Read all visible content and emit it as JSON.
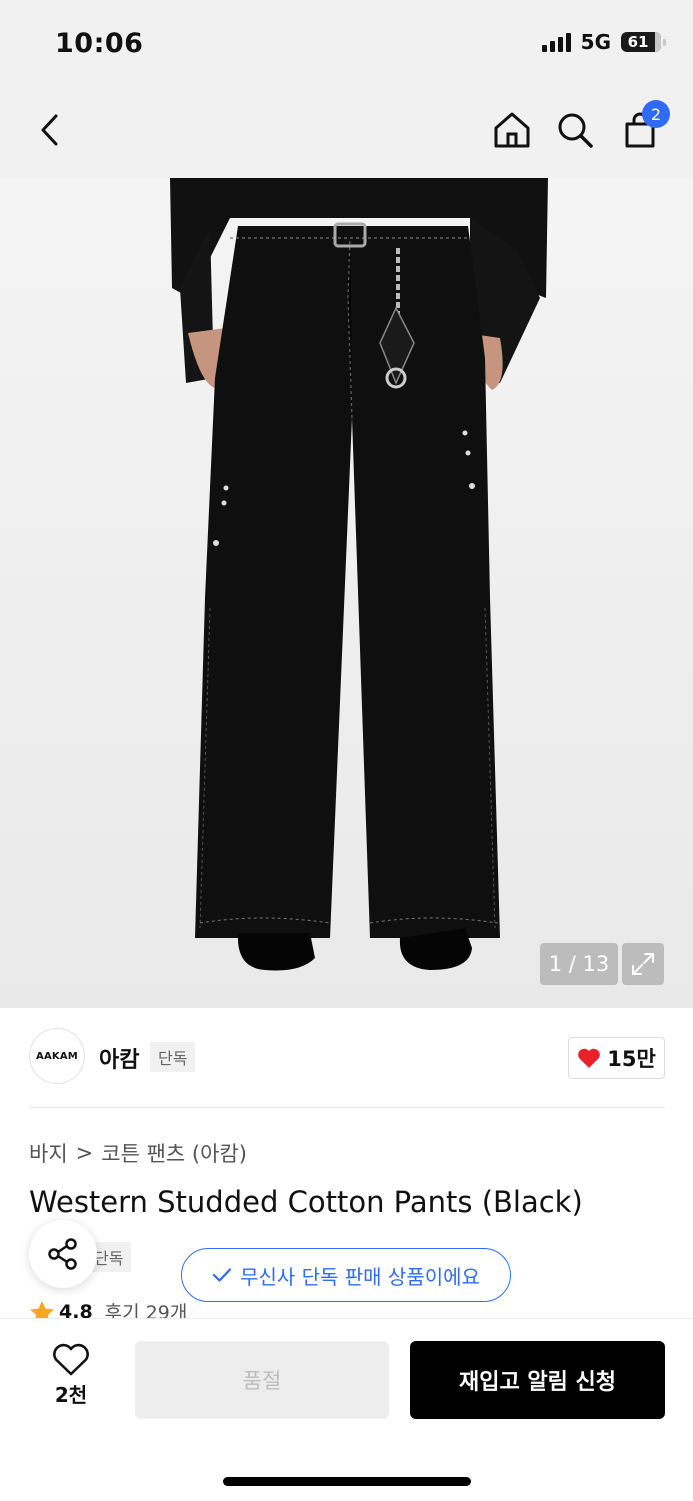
{
  "status_bar": {
    "time": "10:06",
    "network": "5G",
    "battery": "61"
  },
  "nav": {
    "cart_count": "2"
  },
  "gallery": {
    "counter": "1 / 13"
  },
  "brand": {
    "logo_text": "AAKAM",
    "name": "아캄",
    "tag": "단독",
    "likes": "15만"
  },
  "breadcrumb": {
    "category": "바지",
    "separator": ">",
    "subcategory": "코튼 팬츠 (아캄)"
  },
  "product": {
    "title": "Western Studded Cotton Pants (Black)",
    "tag": "단독"
  },
  "toast": {
    "text": "무신사 단독 판매 상품이에요"
  },
  "rating": {
    "score": "4.8",
    "reviews": "후기 29개"
  },
  "bottom": {
    "wish_count": "2천",
    "soldout_label": "품절",
    "restock_label": "재입고 알림 신청"
  },
  "colors": {
    "accent": "#2f6bf6",
    "heart": "#e8212b",
    "star": "#f5a623"
  },
  "icons": [
    "back-icon",
    "home-icon",
    "search-icon",
    "cart-icon",
    "expand-icon",
    "heart-icon",
    "share-icon",
    "check-icon",
    "star-icon",
    "heart-outline-icon"
  ]
}
